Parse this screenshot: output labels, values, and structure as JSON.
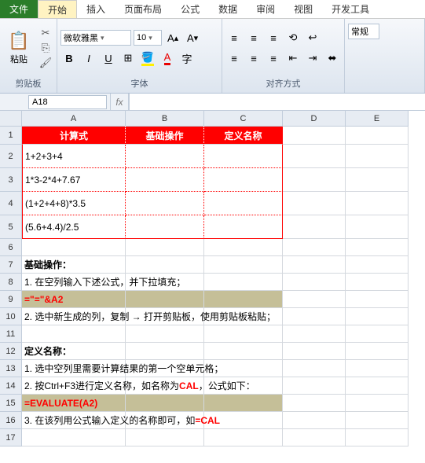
{
  "tabs": [
    "文件",
    "开始",
    "插入",
    "页面布局",
    "公式",
    "数据",
    "审阅",
    "视图",
    "开发工具"
  ],
  "ribbon": {
    "clipboard": {
      "label": "剪贴板",
      "paste": "粘贴"
    },
    "font": {
      "label": "字体",
      "name": "微软雅黑",
      "size": "10"
    },
    "align": {
      "label": "对齐方式"
    },
    "general": "常规"
  },
  "namebox": "A18",
  "fx": "fx",
  "cols": [
    "A",
    "B",
    "C",
    "D",
    "E"
  ],
  "rows": [
    "1",
    "2",
    "3",
    "4",
    "5",
    "6",
    "7",
    "8",
    "9",
    "10",
    "11",
    "12",
    "13",
    "14",
    "15",
    "16",
    "17"
  ],
  "cells": {
    "r1": {
      "a": "计算式",
      "b": "基础操作",
      "c": "定义名称"
    },
    "r2a": "1+2+3+4",
    "r3a": "1*3-2*4+7.67",
    "r4a": "(1+2+4+8)*3.5",
    "r5a": "(5.6+4.4)/2.5",
    "r7a": "基础操作：",
    "r8a": "1. 在空列输入下述公式，并下拉填充；",
    "r9a": "=\"=\"&A2",
    "r10a": "2. 选中新生成的列，复制 → 打开剪贴板，使用剪贴板粘贴；",
    "r12a": "定义名称：",
    "r13a": "1. 选中空列里需要计算结果的第一个空单元格；",
    "r14a_1": "2. 按Ctrl+F3进行定义名称，如名称为",
    "r14a_2": "CAL",
    "r14a_3": "，公式如下：",
    "r15a": "=EVALUATE(A2)",
    "r16a_1": "3. 在该列用公式输入定义的名称即可，如",
    "r16a_2": "=CAL"
  },
  "rowHeights": {
    "default": 23,
    "tall": 30
  }
}
